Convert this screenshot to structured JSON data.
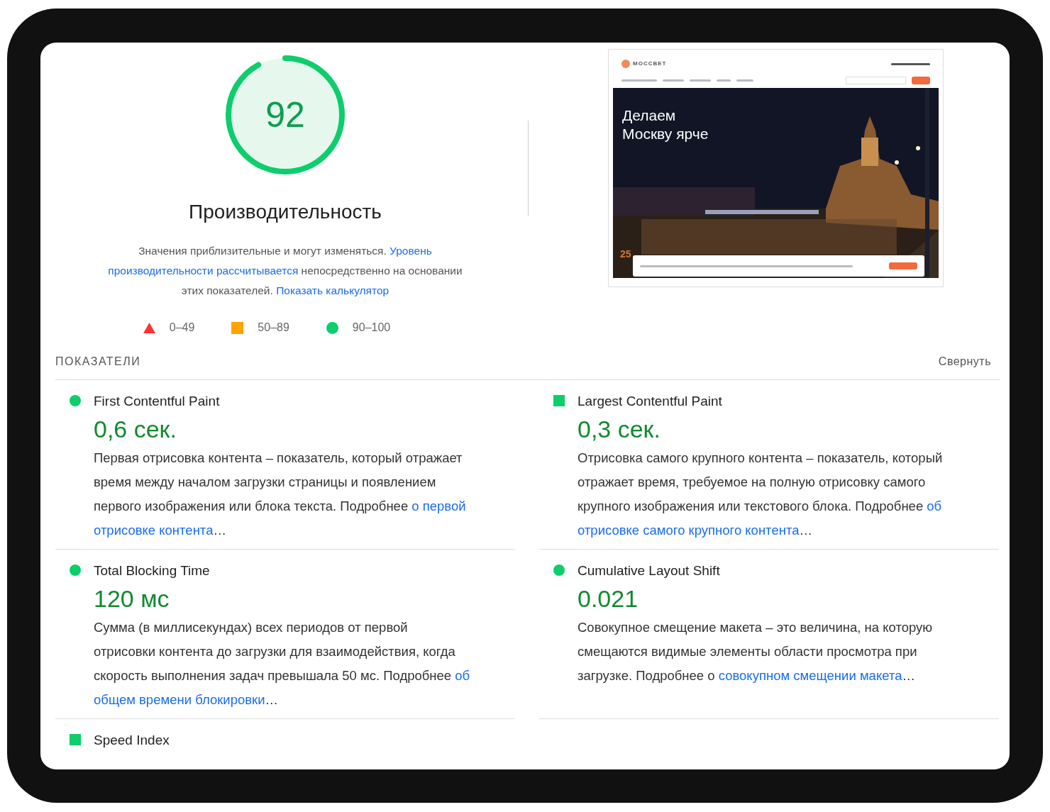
{
  "gauge": {
    "score": "92",
    "level": 0.92
  },
  "category_title": "Производительность",
  "description": [
    [
      {
        "text": "Значения приблизительные и могут изменяться. ",
        "link": "Уровень"
      }
    ],
    [
      {
        "link": "производительности рассчитывается"
      },
      {
        "text": " непосредственно на основании"
      }
    ],
    [
      {
        "text": "этих показателей. ",
        "link": "Показать калькулятор"
      }
    ]
  ],
  "legend": [
    {
      "kind": "triangle",
      "color": "#ff3333",
      "label": "0–49"
    },
    {
      "kind": "square",
      "color": "#ffa400",
      "label": "50–89"
    },
    {
      "kind": "circle",
      "color": "#0cce6b",
      "label": "90–100"
    }
  ],
  "thumbnail": {
    "logo": "МОССВЕТ",
    "headline": [
      "Делаем",
      "Москву ярче"
    ],
    "badge": "25"
  },
  "metrics_header": {
    "title": "ПОКАЗАТЕЛИ",
    "toggle": "Свернуть"
  },
  "metrics": [
    {
      "kind": "circle",
      "title": "First Contentful Paint",
      "value": "0,6 сек.",
      "description": [
        [
          {
            "text": "Первая отрисовка контента – показатель, который отражает"
          }
        ],
        [
          {
            "text": "время между началом загрузки страницы и появлением"
          }
        ],
        [
          {
            "text": "первого изображения или блока текста. Подробнее ",
            "link": "о первой"
          }
        ],
        [
          {
            "link": "отрисовке контента"
          },
          {
            "text": "…"
          }
        ]
      ]
    },
    {
      "kind": "square",
      "title": "Largest Contentful Paint",
      "value": "0,3 сек.",
      "description": [
        [
          {
            "text": "Отрисовка самого крупного контента – показатель, который"
          }
        ],
        [
          {
            "text": "отражает время, требуемое на полную отрисовку самого"
          }
        ],
        [
          {
            "text": "крупного изображения или текстового блока. Подробнее ",
            "link": "об"
          }
        ],
        [
          {
            "link": "отрисовке самого крупного контента"
          },
          {
            "text": "…"
          }
        ]
      ]
    },
    {
      "kind": "circle",
      "title": "Total Blocking Time",
      "value": "120 мс",
      "description": [
        [
          {
            "text": "Сумма (в миллисекундах) всех периодов от первой"
          }
        ],
        [
          {
            "text": "отрисовки контента до загрузки для взаимодействия, когда"
          }
        ],
        [
          {
            "text": "скорость выполнения задач превышала 50 мс. Подробнее ",
            "link": "об"
          }
        ],
        [
          {
            "link": "общем времени блокировки"
          },
          {
            "text": "…"
          }
        ]
      ]
    },
    {
      "kind": "circle",
      "title": "Cumulative Layout Shift",
      "value": "0.021",
      "description": [
        [
          {
            "text": "Совокупное смещение макета – это величина, на которую"
          }
        ],
        [
          {
            "text": "смещаются видимые элементы области просмотра при"
          }
        ],
        [
          {
            "text": "загрузке. Подробнее о ",
            "link": "совокупном смещении макета"
          },
          {
            "text": "…"
          }
        ]
      ]
    },
    {
      "kind": "square",
      "title": "Speed Index"
    }
  ]
}
